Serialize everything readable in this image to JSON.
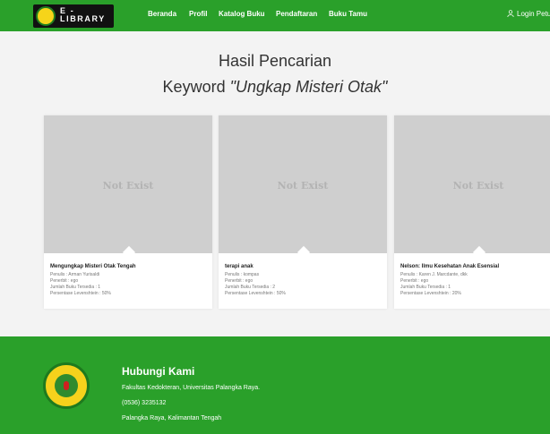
{
  "brand": {
    "line1": "E -",
    "line2": "LIBRARY"
  },
  "nav": {
    "items": [
      "Beranda",
      "Profil",
      "Katalog Buku",
      "Pendaftaran",
      "Buku Tamu"
    ],
    "login_label": "Login Petu"
  },
  "results": {
    "heading": "Hasil Pencarian",
    "keyword_label": "Keyword ",
    "keyword_value": "\"Ungkap Misteri Otak\""
  },
  "cards": [
    {
      "image_text": "Not Exist",
      "title": "Mengungkap Misteri Otak Tengah",
      "author": "Penulis : Arman Yurisaldi",
      "publisher": "Penerbit : ego",
      "stock": "Jumlah Buku Tersedia : 1",
      "score": "Persentase Levenshtein : 50%"
    },
    {
      "image_text": "Not Exist",
      "title": "terapi anak",
      "author": "Penulis : kompas",
      "publisher": "Penerbit : ego",
      "stock": "Jumlah Buku Tersedia : 2",
      "score": "Persentase Levenshtein : 50%"
    },
    {
      "image_text": "Not Exist",
      "title": "Nelson: Ilmu Kesehatan Anak Esensial",
      "author": "Penulis : Karen J. Marcdante, dkk",
      "publisher": "Penerbit : ego",
      "stock": "Jumlah Buku Tersedia : 1",
      "score": "Persentase Levenshtein : 20%"
    }
  ],
  "footer": {
    "title": "Hubungi Kami",
    "address": "Fakultas Kedokteran, Universitas Palangka Raya.",
    "phone": "(0536) 3235132",
    "city": "Palangka Raya, Kalimantan Tengah"
  },
  "colors": {
    "primary_green": "#2aa02a",
    "background": "#f3f3f3",
    "placeholder_gray": "#cfcfcf"
  },
  "icons": {
    "login": "user-icon",
    "brand": "university-logo-icon",
    "seal": "university-seal-icon"
  }
}
